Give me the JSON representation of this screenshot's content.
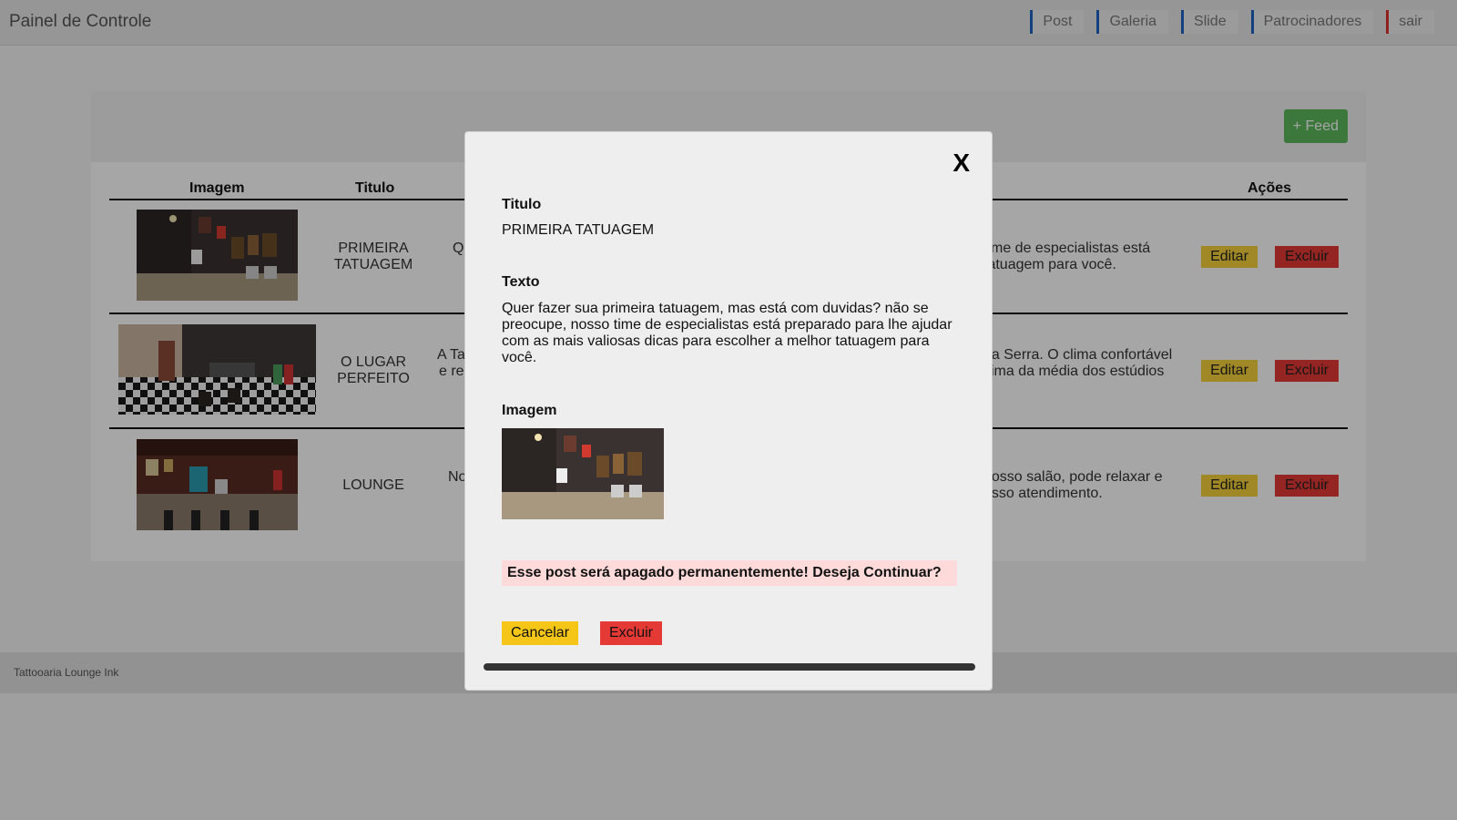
{
  "navbar": {
    "brand": "Painel de Controle",
    "links": [
      "Post",
      "Galeria",
      "Slide",
      "Patrocinadores",
      "sair"
    ]
  },
  "toolbar": {
    "feed_label": "+ Feed"
  },
  "table": {
    "headers": {
      "imagem": "Imagem",
      "titulo": "Titulo",
      "acoes": "Ações"
    },
    "rows": [
      {
        "title_line1": "PRIMEIRA",
        "title_line2": "TATUAGEM",
        "text_left": "Q",
        "text_right_line1": "time de especialistas está",
        "text_right_line2": "tatuagem para você.",
        "edit_label": "Editar",
        "delete_label": "Excluir"
      },
      {
        "title_line1": "O LUGAR",
        "title_line2": "PERFEITO",
        "text_left_line1": "A Ta",
        "text_left_line2": "e re",
        "text_right_line1": "da Serra. O clima confortável",
        "text_right_line2": "cima da média dos estúdios",
        "edit_label": "Editar",
        "delete_label": "Excluir"
      },
      {
        "title_line1": "LOUNGE",
        "text_left": "No",
        "text_right_line1": "nosso salão, pode relaxar e",
        "text_right_line2": "osso atendimento.",
        "edit_label": "Editar",
        "delete_label": "Excluir"
      }
    ]
  },
  "footer": {
    "text": "Tattooaria Lounge Ink"
  },
  "modal": {
    "close_label": "X",
    "titulo_label": "Titulo",
    "titulo_value": "PRIMEIRA TATUAGEM",
    "texto_label": "Texto",
    "texto_value": "Quer fazer sua primeira tatuagem, mas está com duvidas? não se preocupe, nosso time de especialistas está preparado para lhe ajudar com as mais valiosas dicas para escolher a melhor tatuagem para você.",
    "imagem_label": "Imagem",
    "warning": "Esse post será apagado permanentemente! Deseja Continuar?",
    "cancel_label": "Cancelar",
    "delete_label": "Excluir"
  },
  "colors": {
    "nav_accent": "#1f63c5",
    "nav_danger": "#dc2e2e",
    "feed_button": "#5cb85c",
    "edit_button": "#f5d23a",
    "delete_button": "#e53935",
    "warning_bg": "#ffdada"
  }
}
